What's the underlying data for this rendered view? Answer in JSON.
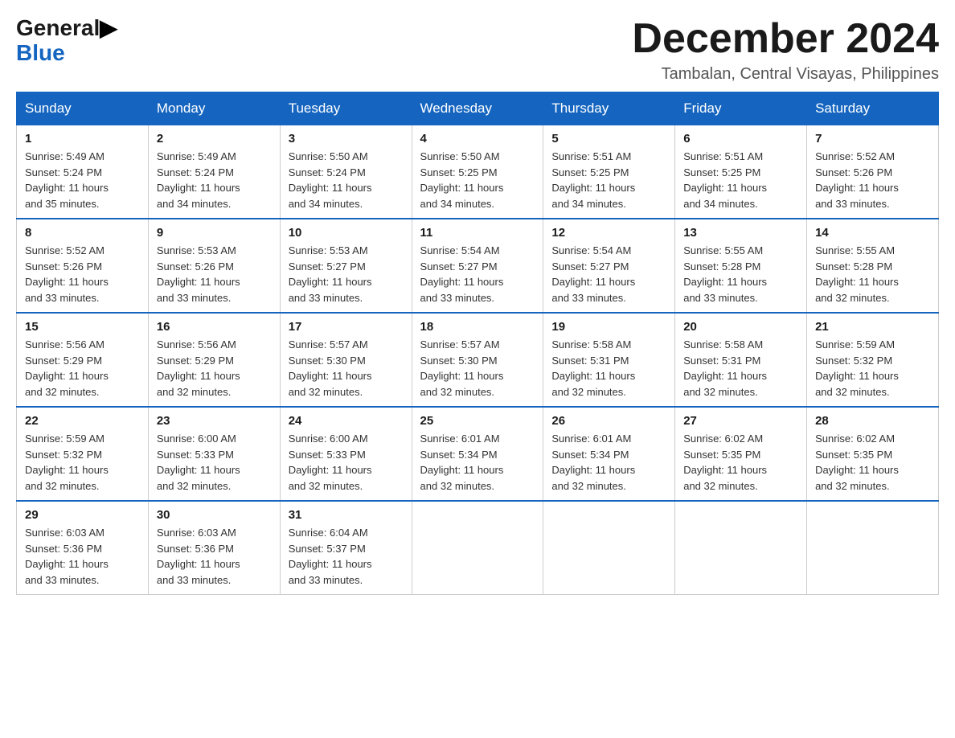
{
  "logo": {
    "line1": "General",
    "line2": "Blue"
  },
  "header": {
    "month": "December 2024",
    "location": "Tambalan, Central Visayas, Philippines"
  },
  "weekdays": [
    "Sunday",
    "Monday",
    "Tuesday",
    "Wednesday",
    "Thursday",
    "Friday",
    "Saturday"
  ],
  "weeks": [
    [
      {
        "day": "1",
        "sunrise": "5:49 AM",
        "sunset": "5:24 PM",
        "daylight": "11 hours and 35 minutes."
      },
      {
        "day": "2",
        "sunrise": "5:49 AM",
        "sunset": "5:24 PM",
        "daylight": "11 hours and 34 minutes."
      },
      {
        "day": "3",
        "sunrise": "5:50 AM",
        "sunset": "5:24 PM",
        "daylight": "11 hours and 34 minutes."
      },
      {
        "day": "4",
        "sunrise": "5:50 AM",
        "sunset": "5:25 PM",
        "daylight": "11 hours and 34 minutes."
      },
      {
        "day": "5",
        "sunrise": "5:51 AM",
        "sunset": "5:25 PM",
        "daylight": "11 hours and 34 minutes."
      },
      {
        "day": "6",
        "sunrise": "5:51 AM",
        "sunset": "5:25 PM",
        "daylight": "11 hours and 34 minutes."
      },
      {
        "day": "7",
        "sunrise": "5:52 AM",
        "sunset": "5:26 PM",
        "daylight": "11 hours and 33 minutes."
      }
    ],
    [
      {
        "day": "8",
        "sunrise": "5:52 AM",
        "sunset": "5:26 PM",
        "daylight": "11 hours and 33 minutes."
      },
      {
        "day": "9",
        "sunrise": "5:53 AM",
        "sunset": "5:26 PM",
        "daylight": "11 hours and 33 minutes."
      },
      {
        "day": "10",
        "sunrise": "5:53 AM",
        "sunset": "5:27 PM",
        "daylight": "11 hours and 33 minutes."
      },
      {
        "day": "11",
        "sunrise": "5:54 AM",
        "sunset": "5:27 PM",
        "daylight": "11 hours and 33 minutes."
      },
      {
        "day": "12",
        "sunrise": "5:54 AM",
        "sunset": "5:27 PM",
        "daylight": "11 hours and 33 minutes."
      },
      {
        "day": "13",
        "sunrise": "5:55 AM",
        "sunset": "5:28 PM",
        "daylight": "11 hours and 33 minutes."
      },
      {
        "day": "14",
        "sunrise": "5:55 AM",
        "sunset": "5:28 PM",
        "daylight": "11 hours and 32 minutes."
      }
    ],
    [
      {
        "day": "15",
        "sunrise": "5:56 AM",
        "sunset": "5:29 PM",
        "daylight": "11 hours and 32 minutes."
      },
      {
        "day": "16",
        "sunrise": "5:56 AM",
        "sunset": "5:29 PM",
        "daylight": "11 hours and 32 minutes."
      },
      {
        "day": "17",
        "sunrise": "5:57 AM",
        "sunset": "5:30 PM",
        "daylight": "11 hours and 32 minutes."
      },
      {
        "day": "18",
        "sunrise": "5:57 AM",
        "sunset": "5:30 PM",
        "daylight": "11 hours and 32 minutes."
      },
      {
        "day": "19",
        "sunrise": "5:58 AM",
        "sunset": "5:31 PM",
        "daylight": "11 hours and 32 minutes."
      },
      {
        "day": "20",
        "sunrise": "5:58 AM",
        "sunset": "5:31 PM",
        "daylight": "11 hours and 32 minutes."
      },
      {
        "day": "21",
        "sunrise": "5:59 AM",
        "sunset": "5:32 PM",
        "daylight": "11 hours and 32 minutes."
      }
    ],
    [
      {
        "day": "22",
        "sunrise": "5:59 AM",
        "sunset": "5:32 PM",
        "daylight": "11 hours and 32 minutes."
      },
      {
        "day": "23",
        "sunrise": "6:00 AM",
        "sunset": "5:33 PM",
        "daylight": "11 hours and 32 minutes."
      },
      {
        "day": "24",
        "sunrise": "6:00 AM",
        "sunset": "5:33 PM",
        "daylight": "11 hours and 32 minutes."
      },
      {
        "day": "25",
        "sunrise": "6:01 AM",
        "sunset": "5:34 PM",
        "daylight": "11 hours and 32 minutes."
      },
      {
        "day": "26",
        "sunrise": "6:01 AM",
        "sunset": "5:34 PM",
        "daylight": "11 hours and 32 minutes."
      },
      {
        "day": "27",
        "sunrise": "6:02 AM",
        "sunset": "5:35 PM",
        "daylight": "11 hours and 32 minutes."
      },
      {
        "day": "28",
        "sunrise": "6:02 AM",
        "sunset": "5:35 PM",
        "daylight": "11 hours and 32 minutes."
      }
    ],
    [
      {
        "day": "29",
        "sunrise": "6:03 AM",
        "sunset": "5:36 PM",
        "daylight": "11 hours and 33 minutes."
      },
      {
        "day": "30",
        "sunrise": "6:03 AM",
        "sunset": "5:36 PM",
        "daylight": "11 hours and 33 minutes."
      },
      {
        "day": "31",
        "sunrise": "6:04 AM",
        "sunset": "5:37 PM",
        "daylight": "11 hours and 33 minutes."
      },
      null,
      null,
      null,
      null
    ]
  ],
  "labels": {
    "sunrise": "Sunrise:",
    "sunset": "Sunset:",
    "daylight": "Daylight:"
  }
}
